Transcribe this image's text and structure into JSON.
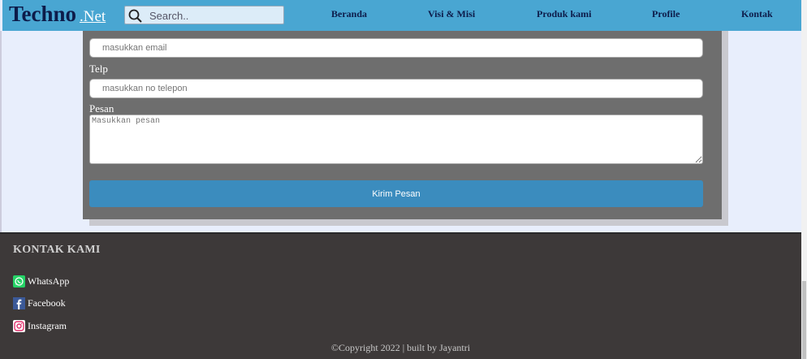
{
  "header": {
    "brand_main": "Techno",
    "brand_suffix": ".Net",
    "search_placeholder": "Search..",
    "nav": [
      "Beranda",
      "Visi & Misi",
      "Produk kami",
      "Profile",
      "Kontak"
    ]
  },
  "form": {
    "email_placeholder": "masukkan email",
    "telp_label": "Telp",
    "telp_placeholder": "masukkan no telepon",
    "pesan_label": "Pesan",
    "pesan_placeholder": "Masukkan pesan",
    "submit_label": "Kirim Pesan"
  },
  "footer": {
    "title": "KONTAK KAMI",
    "social": [
      {
        "label": "WhatsApp",
        "icon": "whatsapp-icon",
        "color": "#25d366"
      },
      {
        "label": "Facebook",
        "icon": "facebook-icon",
        "color": "#3b5998"
      },
      {
        "label": "Instagram",
        "icon": "instagram-icon",
        "color": "#e1306c"
      }
    ],
    "copyright": "©Copyright 2022 | built by Jayantri"
  },
  "colors": {
    "header_bg": "#49a6d2",
    "brand_text": "#0d1c4a",
    "form_bg": "#6e6e6e",
    "button_bg": "#3b8cbe",
    "footer_bg": "#3d3939"
  }
}
